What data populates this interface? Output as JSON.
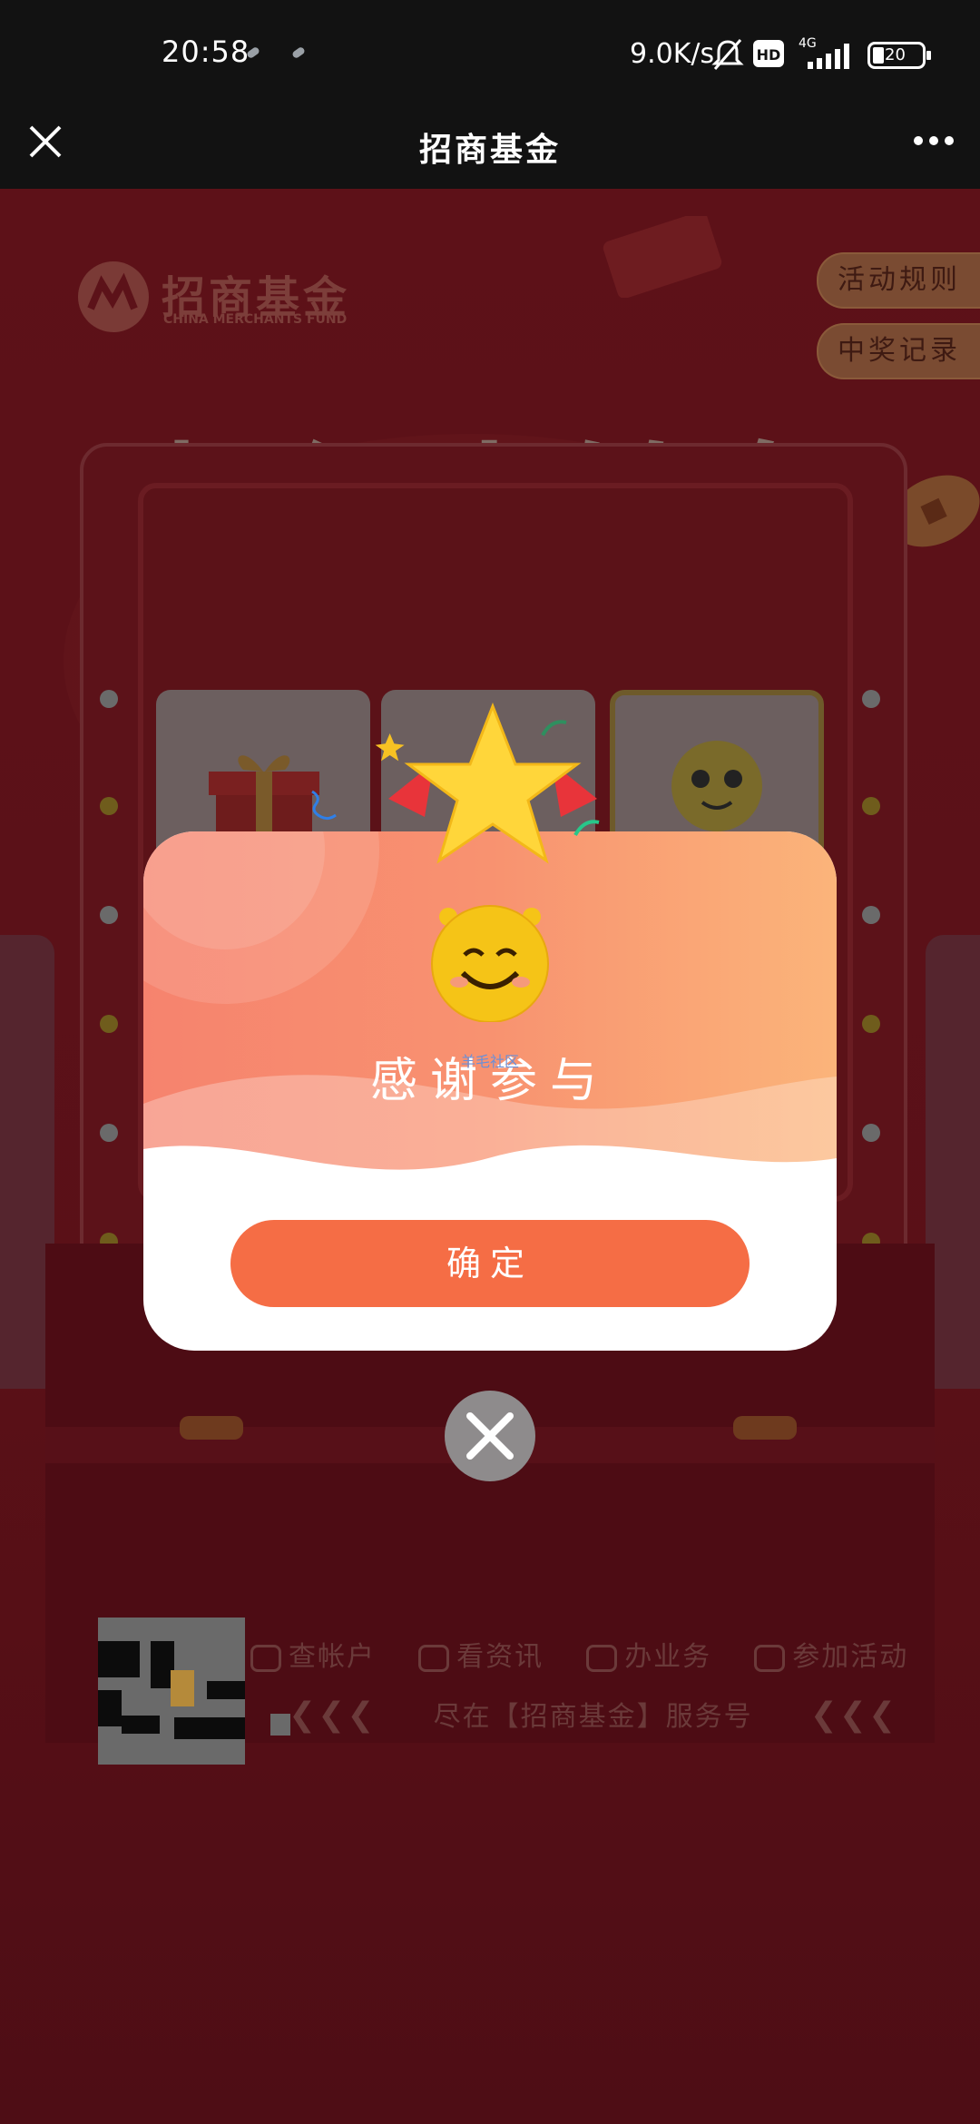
{
  "status_bar": {
    "time": "20:58",
    "net_speed": "9.0K/s",
    "signal_label": "4G",
    "battery": "20"
  },
  "title_bar": {
    "title": "招商基金"
  },
  "page": {
    "logo_cn": "招商基金",
    "logo_en": "CHINA MERCHANTS FUND",
    "rules_button": "活动规则",
    "records_button": "中奖记录",
    "main_title": "超级大转盘"
  },
  "service": {
    "items": [
      "查帐户",
      "看资讯",
      "办业务",
      "参加活动"
    ],
    "slogan": "尽在【招商基金】服务号"
  },
  "modal": {
    "message": "感谢参与",
    "watermark": "羊毛社区",
    "confirm_label": "确定"
  },
  "colors": {
    "primary_button": "#f56d45",
    "modal_gradient_start": "#f6836e",
    "modal_gradient_end": "#fbb47a",
    "page_background": "#5a1017"
  }
}
